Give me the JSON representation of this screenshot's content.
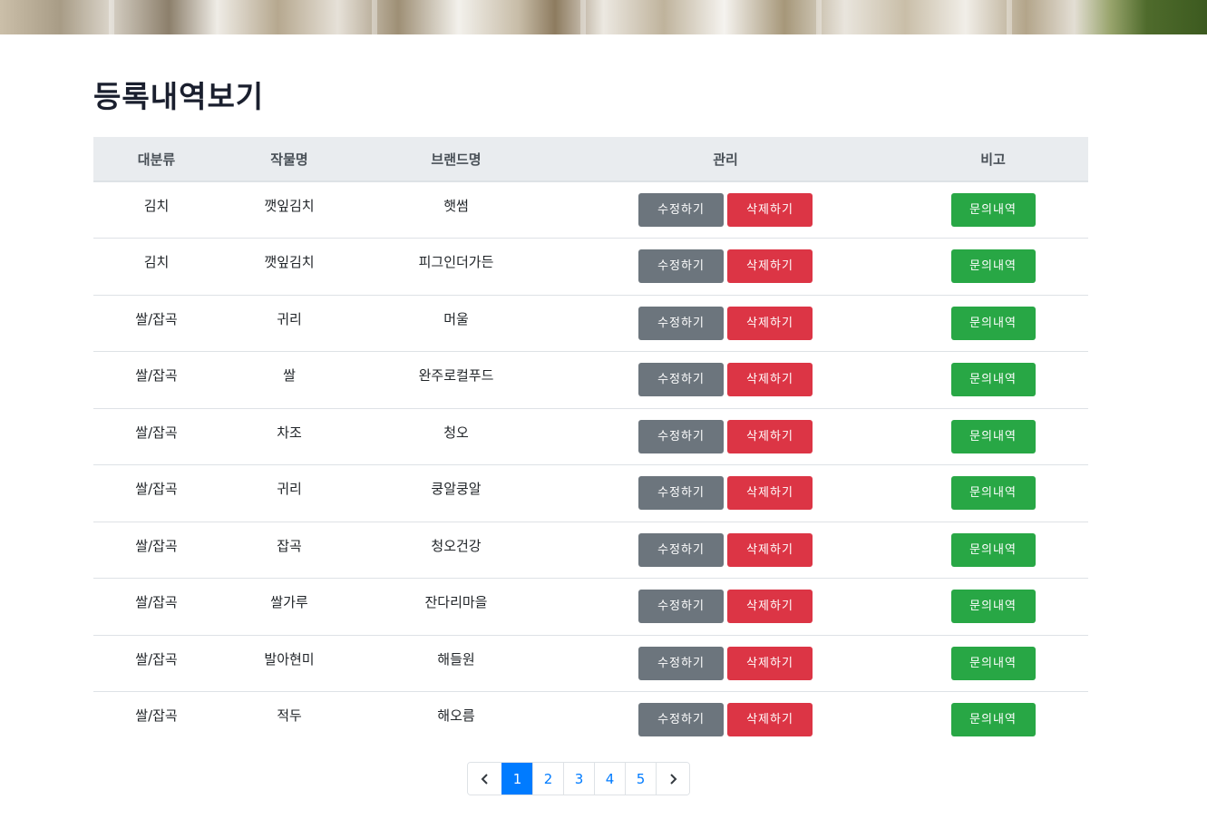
{
  "page": {
    "title": "등록내역보기"
  },
  "table": {
    "headers": [
      "대분류",
      "작물명",
      "브랜드명",
      "관리",
      "비고"
    ],
    "rows": [
      {
        "category": "김치",
        "crop": "깻잎김치",
        "brand": "햇썸"
      },
      {
        "category": "김치",
        "crop": "깻잎김치",
        "brand": "피그인더가든"
      },
      {
        "category": "쌀/잡곡",
        "crop": "귀리",
        "brand": "머울"
      },
      {
        "category": "쌀/잡곡",
        "crop": "쌀",
        "brand": "완주로컬푸드"
      },
      {
        "category": "쌀/잡곡",
        "crop": "차조",
        "brand": "청오"
      },
      {
        "category": "쌀/잡곡",
        "crop": "귀리",
        "brand": "쿵알쿵알"
      },
      {
        "category": "쌀/잡곡",
        "crop": "잡곡",
        "brand": "청오건강"
      },
      {
        "category": "쌀/잡곡",
        "crop": "쌀가루",
        "brand": "잔다리마을"
      },
      {
        "category": "쌀/잡곡",
        "crop": "발아현미",
        "brand": "해들원"
      },
      {
        "category": "쌀/잡곡",
        "crop": "적두",
        "brand": "해오름"
      }
    ],
    "buttons": {
      "edit": "수정하기",
      "delete": "삭제하기",
      "inquiry": "문의내역"
    }
  },
  "pagination": {
    "prev_icon": "chevron-left-icon",
    "next_icon": "chevron-right-icon",
    "pages": [
      "1",
      "2",
      "3",
      "4",
      "5"
    ],
    "current": "1"
  },
  "colors": {
    "edit": "#6c757d",
    "delete": "#dc3545",
    "inquiry": "#28a745",
    "active_page": "#007bff",
    "header_bg": "#e9ecef"
  }
}
